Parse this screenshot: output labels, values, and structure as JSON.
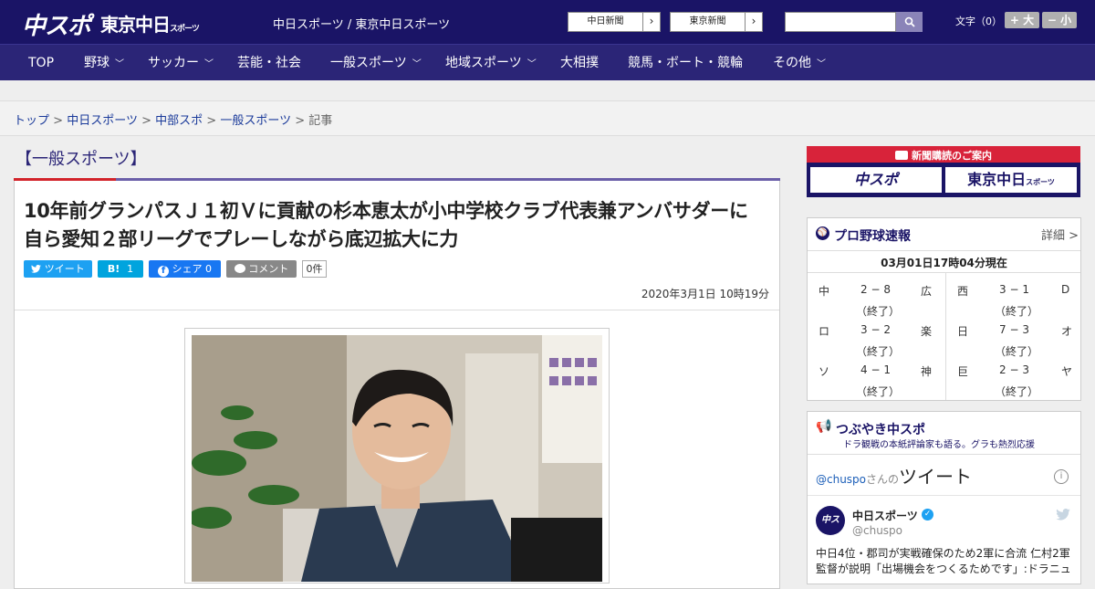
{
  "header": {
    "logo_chuspo": "中スポ",
    "logo_tokyo": "東京中日",
    "logo_tokyo_small": "スポーツ",
    "site_names": "中日スポーツ / 東京中日スポーツ",
    "paper_buttons": [
      "中日新聞",
      "東京新聞"
    ],
    "font_size_label": "文字（0）",
    "font_larger": "+ 大",
    "font_smaller": "− 小"
  },
  "nav": {
    "items": [
      "TOP",
      "野球",
      "サッカー",
      "芸能・社会",
      "一般スポーツ",
      "地域スポーツ",
      "大相撲",
      "競馬・ボート・競輪",
      "その他"
    ]
  },
  "breadcrumb": {
    "items": [
      "トップ",
      "中日スポーツ",
      "中部スポ",
      "一般スポーツ"
    ],
    "current": "記事",
    "sep": ">"
  },
  "article": {
    "section": "【一般スポーツ】",
    "headline": "10年前グランパスＪ１初Ｖに貢献の杉本恵太が小中学校クラブ代表兼アンバサダーに　自ら愛知２部リーグでプレーしながら底辺拡大に力",
    "tweet_label": "ツイート",
    "hatena_label": "B!",
    "hatena_count": "1",
    "share_label": "シェア",
    "share_count": "0",
    "comment_label": "コメント",
    "comment_count": "0件",
    "date": "2020年3月1日 10時19分"
  },
  "sidebar": {
    "subscribe_title": "新聞購読のご案内",
    "subscribe_logo1": "中スポ",
    "subscribe_logo2": "東京中日",
    "subscribe_logo2_small": "スポーツ",
    "baseball": {
      "title": "プロ野球速報",
      "detail": "詳細 >",
      "as_of": "03月01日17時04分現在",
      "games": [
        {
          "home": "中",
          "score": "2 − 8",
          "away": "広",
          "status": "（終了）"
        },
        {
          "home": "西",
          "score": "3 − 1",
          "away": "D",
          "status": "（終了）"
        },
        {
          "home": "ロ",
          "score": "3 − 2",
          "away": "楽",
          "status": "（終了）"
        },
        {
          "home": "日",
          "score": "7 − 3",
          "away": "オ",
          "status": "（終了）"
        },
        {
          "home": "ソ",
          "score": "4 − 1",
          "away": "神",
          "status": "（終了）"
        },
        {
          "home": "巨",
          "score": "2 − 3",
          "away": "ヤ",
          "status": "（終了）"
        }
      ]
    },
    "tweets": {
      "title": "つぶやき中スポ",
      "subtitle": "ドラ観戦の本紙評論家も語る。グラも熱烈応援",
      "handle": "@chuspo",
      "handle_suffix": "さんの",
      "timeline_label": "ツイート",
      "user_name": "中日スポーツ",
      "user_handle": "@chuspo",
      "tweet_text": "中日4位・郡司が実戦確保のため2軍に合流 仁村2軍監督が説明「出場機会をつくるためです」:ドラニュ"
    }
  },
  "colors": {
    "header_bg": "#1a1466",
    "nav_bg": "#2b2577",
    "accent_red": "#d2232a",
    "twitter": "#1da1f2",
    "hatena": "#00a4de",
    "facebook": "#1877f2"
  }
}
